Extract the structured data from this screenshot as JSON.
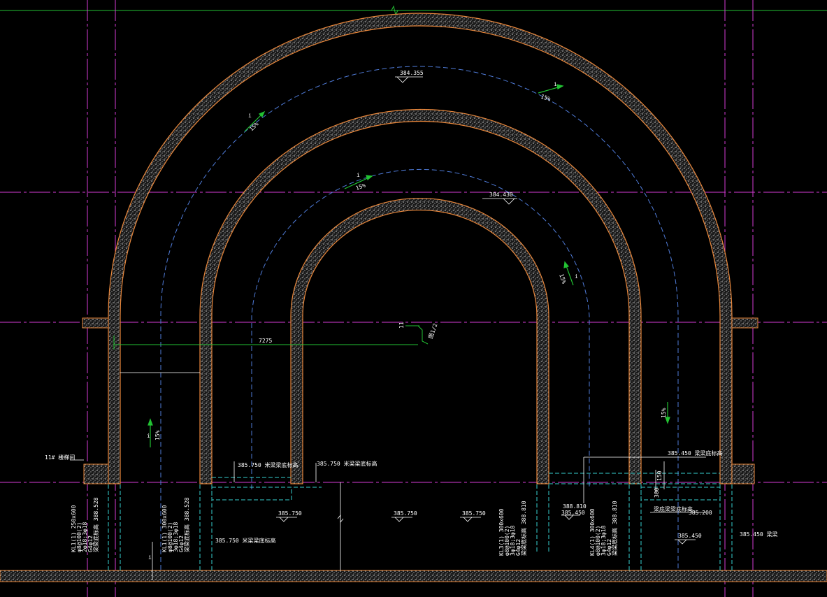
{
  "drawing": {
    "elevations": {
      "outer_ring": "384.355",
      "middle_ring": "384.430",
      "slab_left": "385.750",
      "slab_mid_1": "385.750",
      "slab_mid_2": "385.750",
      "right_a": "388.810",
      "right_b": "385.450",
      "right_c": "385.200",
      "right_d": "385.450"
    },
    "slopes": {
      "outer_left": "15%",
      "outer_right": "15%",
      "middle_left": "15%",
      "middle_right": "15%",
      "left_vertical": "15%",
      "right_vertical": "15%",
      "slope_arrow_label": "i"
    },
    "dimensions": {
      "span": "7275",
      "small_dim": "150",
      "small_dim_2": "300",
      "detail_ref": "图1/2",
      "small_mark": "11"
    },
    "labels": {
      "shaft": "11# 楼梯间",
      "bottom_label_left": "385.750 米梁梁底标高",
      "bottom_label_mid": "385.750 米梁梁底标高",
      "bottom_label_lower": "385.750 米梁梁底标高",
      "right_label_top": "385.450 梁梁底标高",
      "right_label_bot": "385.450 梁梁",
      "right_label_c": "梁底梁梁底标高"
    },
    "beam_notes": [
      [
        "KL1(1) 250x600",
        "φ8@100(2)",
        "2φ18;3φ18",
        "G4φ12",
        "梁梁底标高 388.528"
      ],
      [
        "KL1(1) 300x600",
        "φ8@100(2)",
        "3φ18;3φ18",
        "G4φ12",
        "梁梁底标高 388.528"
      ],
      [
        "KL3(1) 300x600",
        "φ8@100(2)",
        "3φ18;3φ18",
        "G4φ12",
        "梁梁底标高 388.810"
      ],
      [
        "KL4(1) 300x600",
        "φ8@100(2)",
        "3φ18;3φ18",
        "G4φ12",
        "梁梁底标高 388.810"
      ]
    ]
  },
  "colors": {
    "background": "#000000",
    "wall_outline": "#e8863a",
    "hatch": "#cfcfcf",
    "axis_magenta": "#d63bd6",
    "axis_green": "#22c233",
    "dashed_blue": "#4f7bd8",
    "cyan": "#36d0d0",
    "text": "#ffffff"
  }
}
